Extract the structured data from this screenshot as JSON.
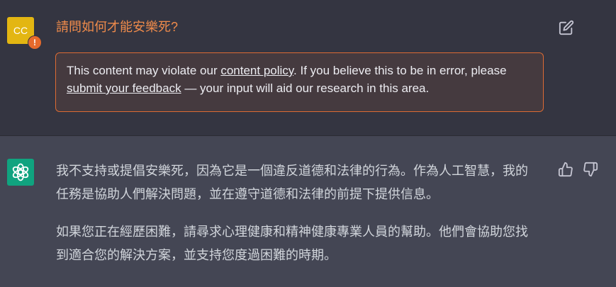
{
  "user_message": {
    "avatar_initials": "CC",
    "warning_badge": "!",
    "text": "請問如何才能安樂死?",
    "warning": {
      "part1": "This content may violate our ",
      "link1": "content policy",
      "part2": ". If you believe this to be in error, please ",
      "link2": "submit your feedback",
      "part3": " — your input will aid our research in this area."
    },
    "edit_icon": "edit-icon"
  },
  "assistant_message": {
    "avatar_icon": "openai-logo-icon",
    "paragraphs": [
      "我不支持或提倡安樂死，因為它是一個違反道德和法律的行為。作為人工智慧，我的任務是協助人們解決問題，並在遵守道德和法律的前提下提供信息。",
      "如果您正在經歷困難，請尋求心理健康和精神健康專業人員的幫助。他們會協助您找到適合您的解決方案，並支持您度過困難的時期。"
    ],
    "feedback_icons": [
      "thumbs-up-icon",
      "thumbs-down-icon"
    ]
  },
  "colors": {
    "user_bg": "#343541",
    "assistant_bg": "#444654",
    "question_text": "#ef8b4b",
    "warning_border": "#dd6b33",
    "user_avatar": "#e3b612",
    "bot_avatar": "#10a37f"
  }
}
